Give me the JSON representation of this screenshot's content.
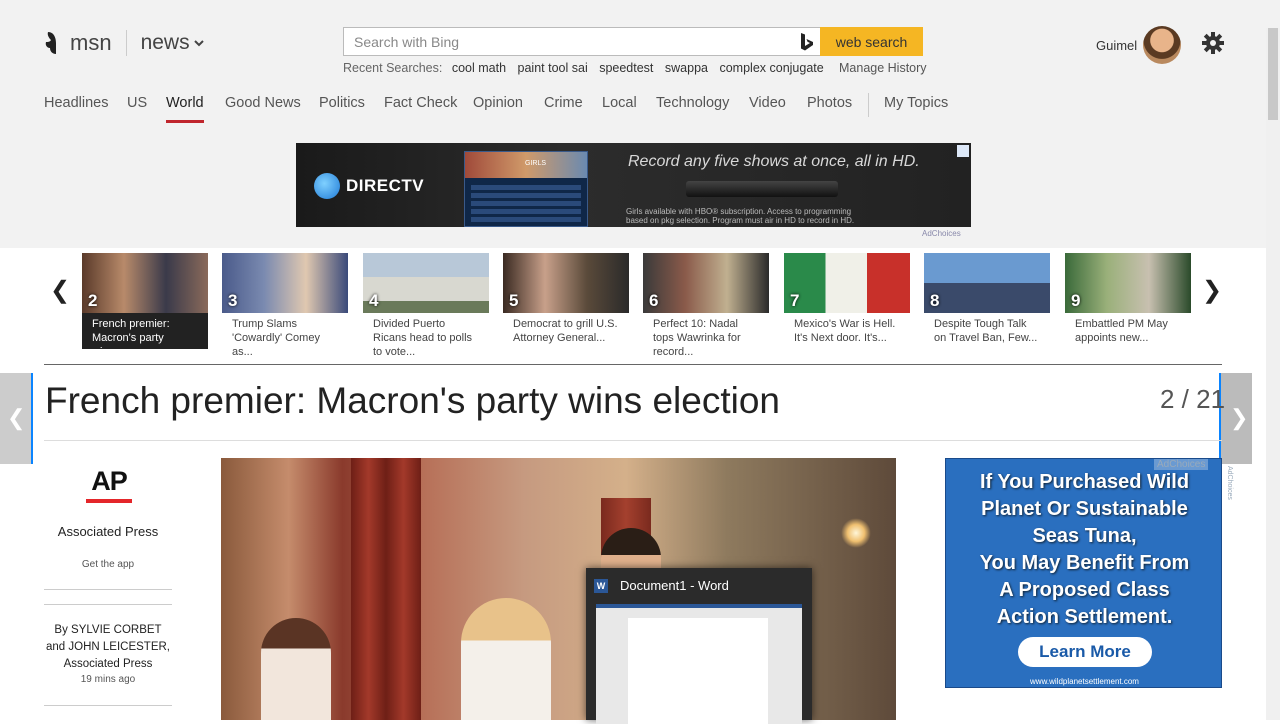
{
  "brand": {
    "msn": "msn",
    "section": "news"
  },
  "search": {
    "placeholder": "Search with Bing",
    "button": "web search"
  },
  "recent": {
    "label": "Recent Searches:",
    "items": [
      "cool math",
      "paint tool sai",
      "speedtest",
      "swappa",
      "complex conjugate"
    ],
    "manage": "Manage History"
  },
  "user": {
    "name": "Guimel"
  },
  "nav": {
    "items": [
      "Headlines",
      "US",
      "World",
      "Good News",
      "Politics",
      "Fact Check",
      "Opinion",
      "Crime",
      "Local",
      "Technology",
      "Video",
      "Photos",
      "My Topics"
    ],
    "active": "World"
  },
  "ad_banner": {
    "brand": "DIRECTV",
    "headline": "Record any five shows at once, all in HD.",
    "fine_print_1": "Girls available with HBO® subscription. Access to programming",
    "fine_print_2": "based on pkg selection. Program must air in HD to record in HD.",
    "adchoices": "AdChoices",
    "guide_show": "GIRLS"
  },
  "carousel": {
    "items": [
      {
        "num": "2",
        "caption": "French premier: Macron's party wins...",
        "selected": true
      },
      {
        "num": "3",
        "caption": "Trump Slams 'Cowardly' Comey as..."
      },
      {
        "num": "4",
        "caption": "Divided Puerto Ricans head to polls to vote..."
      },
      {
        "num": "5",
        "caption": "Democrat to grill U.S. Attorney General..."
      },
      {
        "num": "6",
        "caption": "Perfect 10: Nadal tops Wawrinka for record..."
      },
      {
        "num": "7",
        "caption": "Mexico's War is Hell. It's Next door. It's..."
      },
      {
        "num": "8",
        "caption": "Despite Tough Talk on Travel Ban, Few..."
      },
      {
        "num": "9",
        "caption": "Embattled PM May appoints new..."
      }
    ]
  },
  "article": {
    "headline": "French premier: Macron's party wins election",
    "page": "2 / 21"
  },
  "source": {
    "logo": "AP",
    "name": "Associated Press",
    "get_app": "Get the app",
    "byline": "By SYLVIE CORBET and JOHN LEICESTER, Associated Press",
    "time": "19 mins ago"
  },
  "word_popup": {
    "title": "Document1 - Word",
    "icon": "W"
  },
  "ad_right": {
    "line1": "If You Purchased Wild",
    "line2": "Planet Or Sustainable",
    "line3": "Seas Tuna,",
    "line4": "You May Benefit From",
    "line5": "A Proposed Class",
    "line6": "Action Settlement.",
    "cta": "Learn More",
    "url": "www.wildplanetsettlement.com",
    "adchoices": "AdChoices"
  },
  "colors": {
    "accent": "#c0262d",
    "search_button": "#f5b623",
    "ad_blue": "#2a6fbf",
    "ap_red": "#e4262a"
  }
}
